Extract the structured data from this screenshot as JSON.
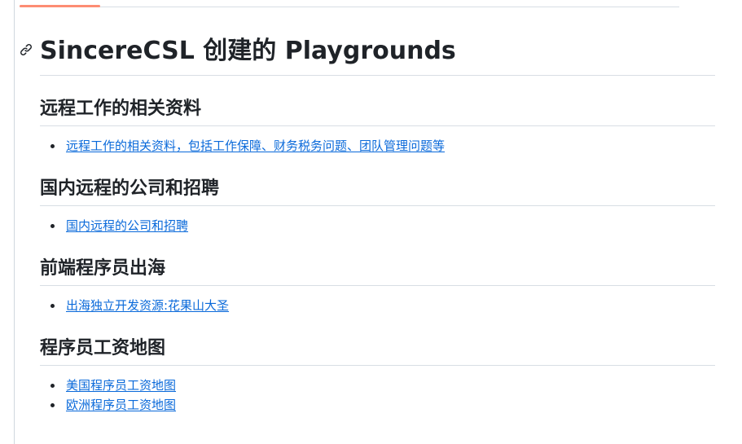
{
  "page": {
    "title": "SincereCSL 创建的 Playgrounds",
    "anchor_icon": "link-icon",
    "accent_color": "#fd8c73",
    "link_color": "#0969da"
  },
  "sections": [
    {
      "heading": "远程工作的相关资料",
      "links": [
        "远程工作的相关资料，包括工作保障、财务税务问题、团队管理问题等"
      ]
    },
    {
      "heading": "国内远程的公司和招聘",
      "links": [
        "国内远程的公司和招聘"
      ]
    },
    {
      "heading": "前端程序员出海",
      "links": [
        "出海独立开发资源:花果山大圣"
      ]
    },
    {
      "heading": "程序员工资地图",
      "links": [
        "美国程序员工资地图",
        "欧洲程序员工资地图"
      ]
    }
  ]
}
